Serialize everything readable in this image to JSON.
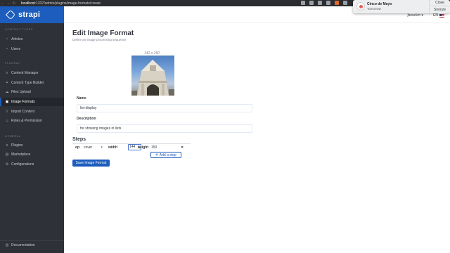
{
  "browser": {
    "url_host": "localhost",
    "url_path": ":1337/admin/plugins/image-formats/create"
  },
  "notification": {
    "title": "Cinco de Mayo",
    "subtitle": "Tomorrow",
    "close_label": "Close",
    "snooze_label": "Snooze"
  },
  "sidebar": {
    "brand": "strapi",
    "content_types_title": "Content Types",
    "content_types": [
      {
        "label": "Articles"
      },
      {
        "label": "Users"
      }
    ],
    "plugins_title": "Plugins",
    "plugins": [
      {
        "label": "Content Manager",
        "icon": "list-icon"
      },
      {
        "label": "Content Type Builder",
        "icon": "puzzle-icon"
      },
      {
        "label": "Files Upload",
        "icon": "cloud-upload-icon"
      },
      {
        "label": "Image Formats",
        "icon": "image-icon",
        "active": true
      },
      {
        "label": "Import Content",
        "icon": "download-icon"
      },
      {
        "label": "Roles & Permission",
        "icon": "users-icon"
      }
    ],
    "general_title": "General",
    "general": [
      {
        "label": "Plugins",
        "icon": "puzzle-icon"
      },
      {
        "label": "Marketplace",
        "icon": "shop-icon"
      },
      {
        "label": "Configurations",
        "icon": "gear-icon"
      }
    ],
    "footer": {
      "label": "Documentation",
      "icon": "book-icon"
    }
  },
  "header": {
    "user": "jbeuckm",
    "lang": "EN"
  },
  "page": {
    "title": "Edit Image Format",
    "subtitle": "Define an image processing sequence",
    "preview_dims": "141 x 150",
    "name_label": "Name",
    "name_value": "list-display",
    "description_label": "Description",
    "description_value": "for showing images in lists",
    "steps_title": "Steps",
    "step": {
      "op_label": "op",
      "op_value": "cover",
      "width_label": "width",
      "width_value": "144",
      "height_label": "height",
      "height_value": "150",
      "remove_icon": "✕"
    },
    "add_step_label": "Add a step",
    "save_label": "Save Image Format"
  },
  "colors": {
    "brand": "#1c5dbd",
    "sidebar_bg": "#2e3137"
  }
}
